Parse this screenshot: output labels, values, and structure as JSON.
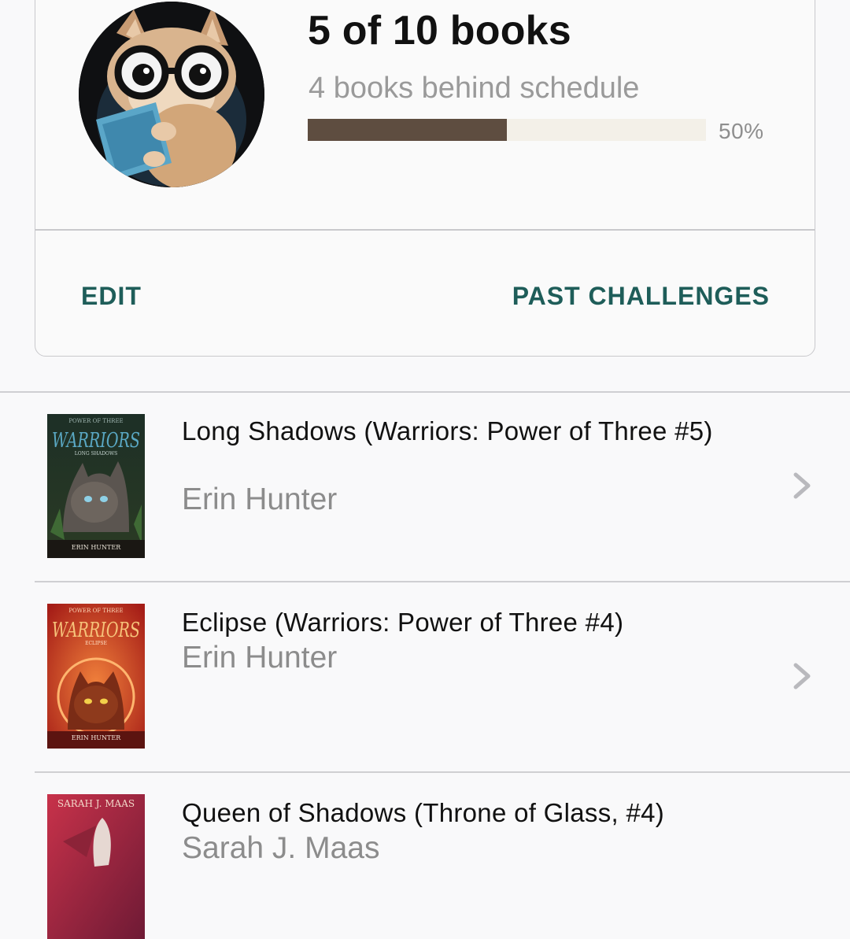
{
  "challenge": {
    "count_title": "5 of 10 books",
    "status": "4 books behind schedule",
    "progress": 0.5,
    "progress_label": "50%",
    "avatar_icon": "cat-reading-icon",
    "actions": {
      "edit": "EDIT",
      "past": "PAST CHALLENGES"
    }
  },
  "books": [
    {
      "title": "Long Shadows (Warriors: Power of Three #5)",
      "author": "Erin Hunter",
      "cover": {
        "series": "WARRIORS",
        "top_line": "POWER OF THREE",
        "subtitle": "LONG SHADOWS",
        "author_line": "ERIN HUNTER"
      }
    },
    {
      "title": "Eclipse (Warriors: Power of Three #4)",
      "author": "Erin Hunter",
      "cover": {
        "series": "WARRIORS",
        "top_line": "POWER OF THREE",
        "subtitle": "ECLIPSE",
        "author_line": "ERIN HUNTER"
      }
    },
    {
      "title": "Queen of Shadows (Throne of Glass, #4)",
      "author": "Sarah J. Maas",
      "cover": {
        "author_line": "SARAH J. MAAS"
      }
    }
  ],
  "colors": {
    "accent": "#1e5d59",
    "progress_fill": "#5e4d40",
    "progress_track": "#f3f0e8",
    "secondary_text": "#8c8c8c"
  }
}
